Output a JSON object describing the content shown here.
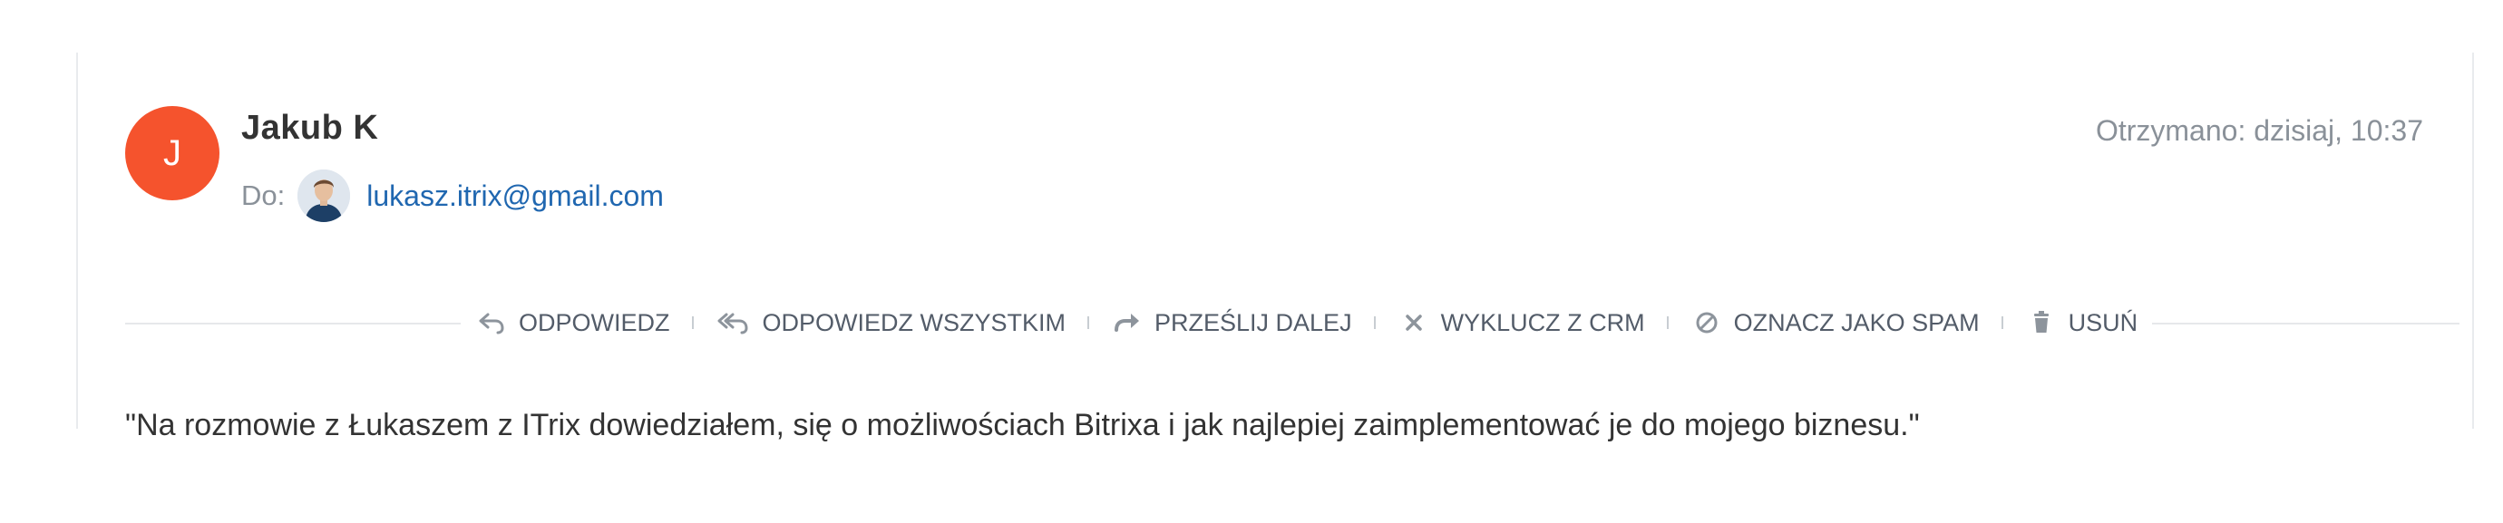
{
  "sender": {
    "initial": "J",
    "name": "Jakub K",
    "avatar_color": "#f5532d"
  },
  "received": "Otrzymano: dzisiaj, 10:37",
  "recipient": {
    "label": "Do:",
    "email": "lukasz.itrix@gmail.com",
    "link_color": "#2067b0"
  },
  "actions": [
    {
      "label": "ODPOWIEDZ",
      "icon": "reply-icon"
    },
    {
      "label": "ODPOWIEDZ WSZYSTKIM",
      "icon": "reply-all-icon"
    },
    {
      "label": "PRZEŚLIJ DALEJ",
      "icon": "forward-icon"
    },
    {
      "label": "WYKLUCZ Z CRM",
      "icon": "close-icon"
    },
    {
      "label": "OZNACZ JAKO SPAM",
      "icon": "spam-icon"
    },
    {
      "label": "USUŃ",
      "icon": "trash-icon"
    }
  ],
  "message": {
    "body": "\"Na rozmowie z Łukaszem z ITrix dowiedziałem, się o możliwościach Bitrixa i jak najlepiej zaimplementować je do mojego biznesu.\""
  }
}
